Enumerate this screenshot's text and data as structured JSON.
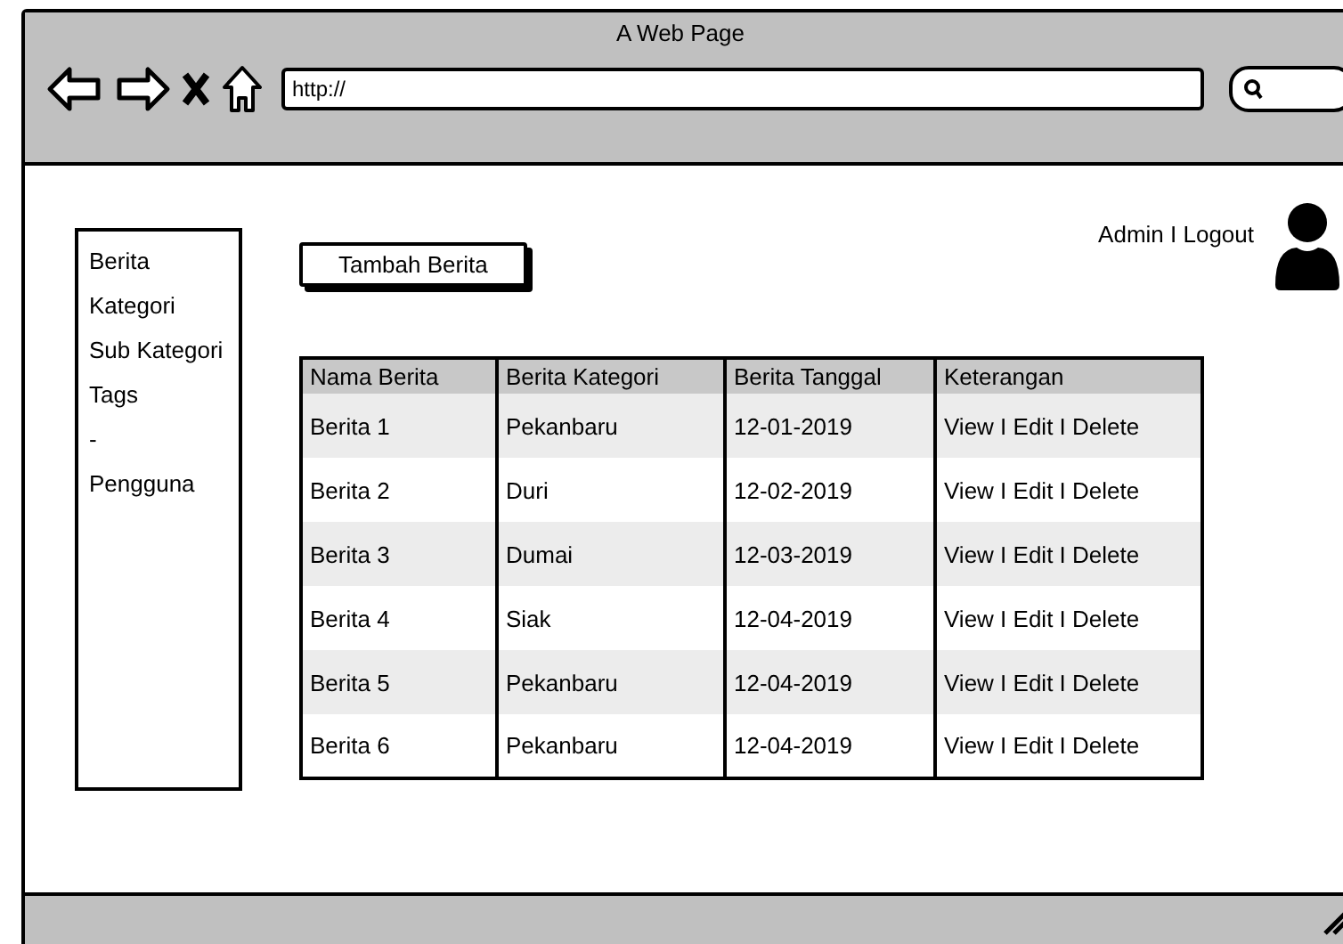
{
  "window": {
    "title": "A Web Page"
  },
  "address_bar": {
    "value": "http://"
  },
  "sidebar": {
    "items": [
      "Berita",
      "Kategori",
      "Sub Kategori",
      "Tags",
      "-",
      "Pengguna"
    ]
  },
  "add_button": "Tambah Berita",
  "user_menu": "Admin I Logout",
  "table": {
    "columns": [
      "Nama Berita",
      "Berita Kategori",
      "Berita Tanggal",
      "Keterangan"
    ],
    "rows": [
      [
        "Berita 1",
        "Pekanbaru",
        "12-01-2019",
        "View I Edit I Delete"
      ],
      [
        "Berita 2",
        "Duri",
        "12-02-2019",
        "View I Edit I Delete"
      ],
      [
        "Berita 3",
        "Dumai",
        "12-03-2019",
        "View I Edit I Delete"
      ],
      [
        "Berita 4",
        "Siak",
        "12-04-2019",
        "View I Edit I Delete"
      ],
      [
        "Berita 5",
        "Pekanbaru",
        "12-04-2019",
        "View I Edit I Delete"
      ],
      [
        "Berita 6",
        "Pekanbaru",
        "12-04-2019",
        "View I Edit I Delete"
      ]
    ]
  }
}
